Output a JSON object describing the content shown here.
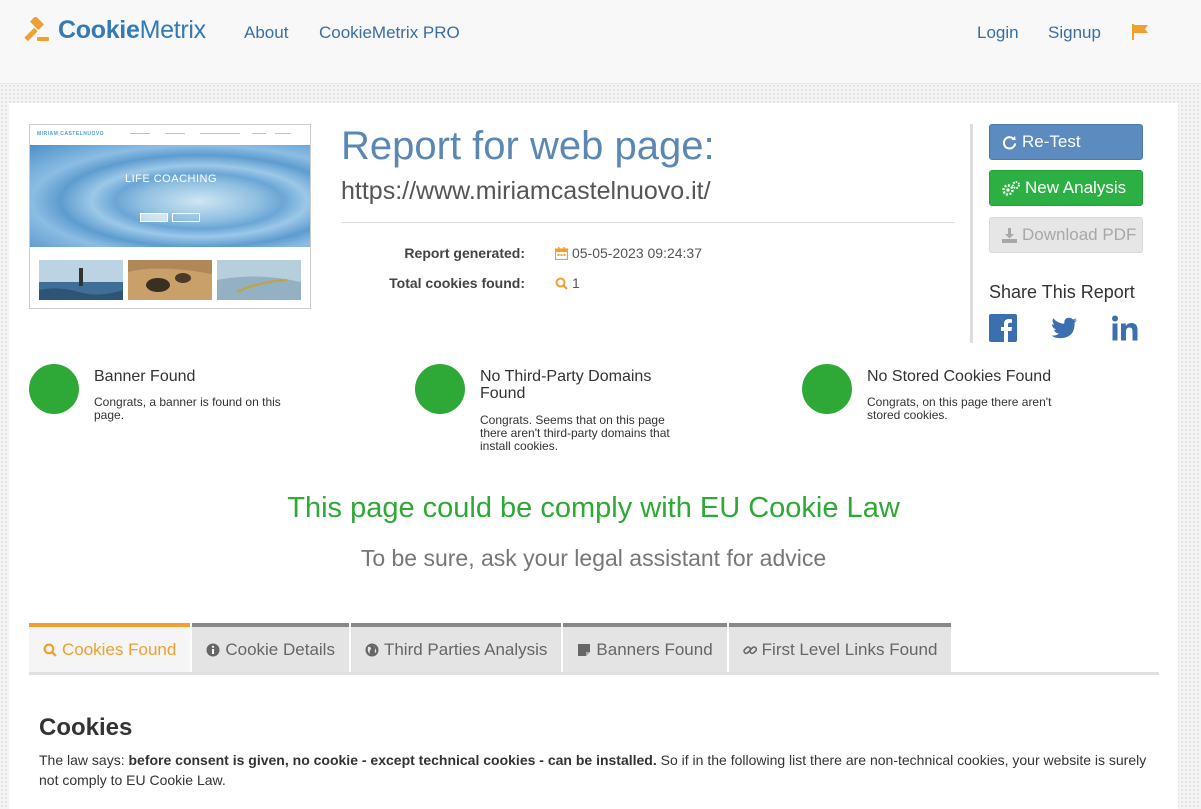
{
  "nav": {
    "brand_bold": "Cookie",
    "brand_rest": "Metrix",
    "about": "About",
    "pro": "CookieMetrix PRO",
    "login": "Login",
    "signup": "Signup"
  },
  "preview": {
    "site_logo": "MIRIAM CASTELNUOVO",
    "hero_text": "LIFE COACHING"
  },
  "report": {
    "title": "Report for web page:",
    "url": "https://www.miriamcastelnuovo.it/",
    "generated_label": "Report generated:",
    "generated_value": "05-05-2023 09:24:37",
    "cookies_label": "Total cookies found:",
    "cookies_value": "1"
  },
  "actions": {
    "retest": "Re-Test",
    "new_analysis": "New Analysis",
    "download_pdf": "Download PDF",
    "share_title": "Share This Report"
  },
  "checks": [
    {
      "title": "Banner Found",
      "text": "Congrats, a banner is found on this page."
    },
    {
      "title": "No Third-Party Domains Found",
      "text": "Congrats. Seems that on this page there aren't third-party domains that install cookies."
    },
    {
      "title": "No Stored Cookies Found",
      "text": "Congrats, on this page there aren't stored cookies."
    }
  ],
  "verdict": "This page could be comply with EU Cookie Law",
  "advice": "To be sure, ask your legal assistant for advice",
  "tabs": [
    {
      "label": "Cookies Found",
      "icon": "search-icon"
    },
    {
      "label": "Cookie Details",
      "icon": "info-icon"
    },
    {
      "label": "Third Parties Analysis",
      "icon": "globe-icon"
    },
    {
      "label": "Banners Found",
      "icon": "note-icon"
    },
    {
      "label": "First Level Links Found",
      "icon": "link-icon"
    }
  ],
  "cookies_section": {
    "title": "Cookies",
    "law_prefix": "The law says: ",
    "law_bold": "before consent is given, no cookie - except technical cookies - can be installed.",
    "law_suffix": " So if in the following list there are non-technical cookies, your website is surely not comply to EU Cookie Law."
  },
  "colors": {
    "brand_blue": "#337ab7",
    "success_green": "#2ea836",
    "accent_orange": "#f0a030"
  }
}
